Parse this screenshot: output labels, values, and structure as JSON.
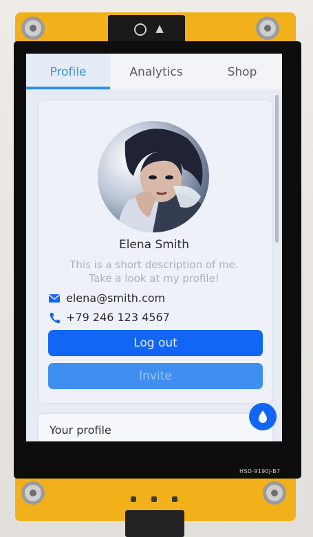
{
  "tabs": [
    {
      "label": "Profile",
      "active": true
    },
    {
      "label": "Analytics",
      "active": false
    },
    {
      "label": "Shop",
      "active": false
    }
  ],
  "profile": {
    "name": "Elena Smith",
    "description_line1": "This is a short description of me.",
    "description_line2": "Take a look at my profile!",
    "email": "elena@smith.com",
    "phone": "+79 246 123 4567",
    "logout_label": "Log out",
    "invite_label": "Invite"
  },
  "profile_section": {
    "title": "Your profile"
  },
  "device": {
    "model_label": "HSD-9190J-B7"
  },
  "colors": {
    "accent": "#1266f5",
    "tab_active": "#3b8fe0",
    "invite_button": "#3f8ff0",
    "pcb": "#f2b11a"
  },
  "icons": {
    "email": "envelope-icon",
    "phone": "phone-icon",
    "fab": "droplet-icon"
  }
}
